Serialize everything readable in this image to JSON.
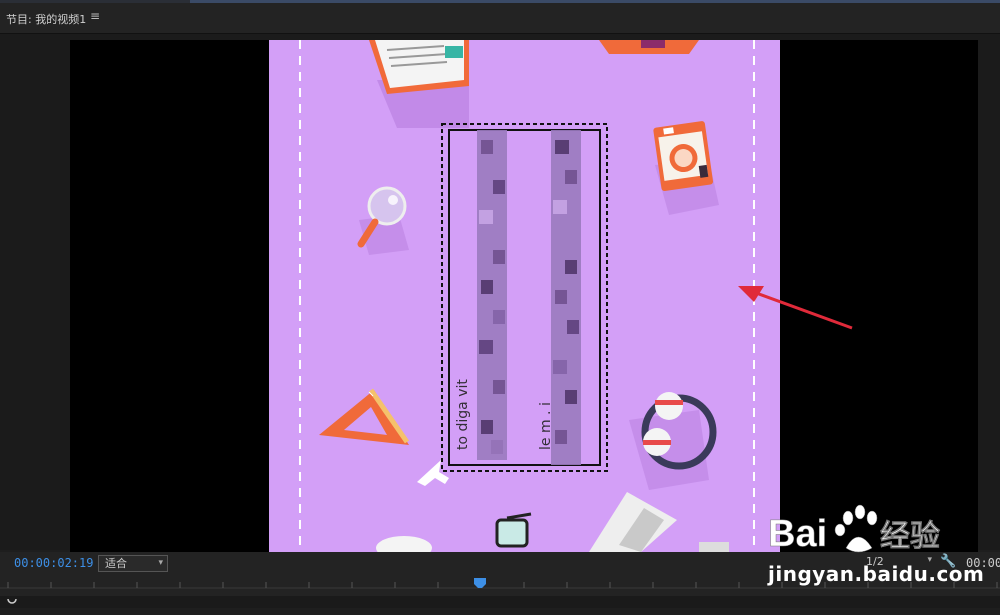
{
  "panel": {
    "title": "节目: 我的视频1",
    "menu_icon": "≡"
  },
  "controls": {
    "timecode": "00:00:02:19",
    "fit_label": "适合",
    "resolution": "1/2",
    "duration": "00:00"
  },
  "watermark": {
    "brand": "Bai",
    "brand_cn": "经验",
    "url": "jingyan.baidu.com"
  },
  "colors": {
    "canvas_bg": "#d39ff7",
    "timecode": "#3d8fe6",
    "arrow": "#e02a3a",
    "accent_orange": "#f06a3a"
  },
  "icons": [
    "document-icon",
    "magnifier-icon",
    "camera-icon",
    "ruler-triangle-icon",
    "headphones-icon",
    "glasses-icon",
    "laptop-icon",
    "cursor-icon",
    "wrench-icon",
    "playhead-icon",
    "baidu-paw-icon"
  ]
}
